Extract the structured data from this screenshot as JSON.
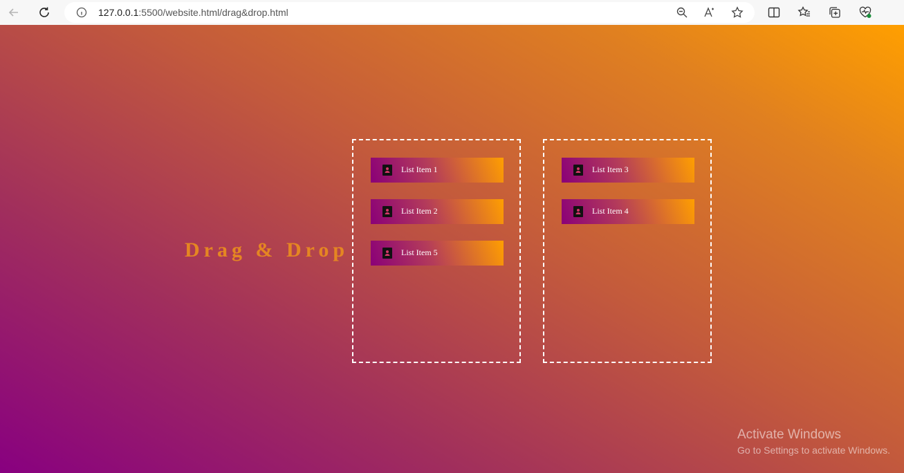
{
  "browser": {
    "url_host": "127.0.0.1",
    "url_rest": ":5500/website.html/drag&drop.html"
  },
  "page": {
    "title": "Drag & Drop",
    "left_list": [
      {
        "label": "List Item 1"
      },
      {
        "label": "List Item 2"
      },
      {
        "label": "List Item 5"
      }
    ],
    "right_list": [
      {
        "label": "List Item 3"
      },
      {
        "label": "List Item 4"
      }
    ]
  },
  "watermark": {
    "title": "Activate Windows",
    "subtitle": "Go to Settings to activate Windows."
  },
  "colors": {
    "title": "#e58622",
    "gradient_start": "#880080",
    "gradient_end": "#ff9f00",
    "item_start": "#8a0078",
    "item_end": "#ff9f00"
  }
}
